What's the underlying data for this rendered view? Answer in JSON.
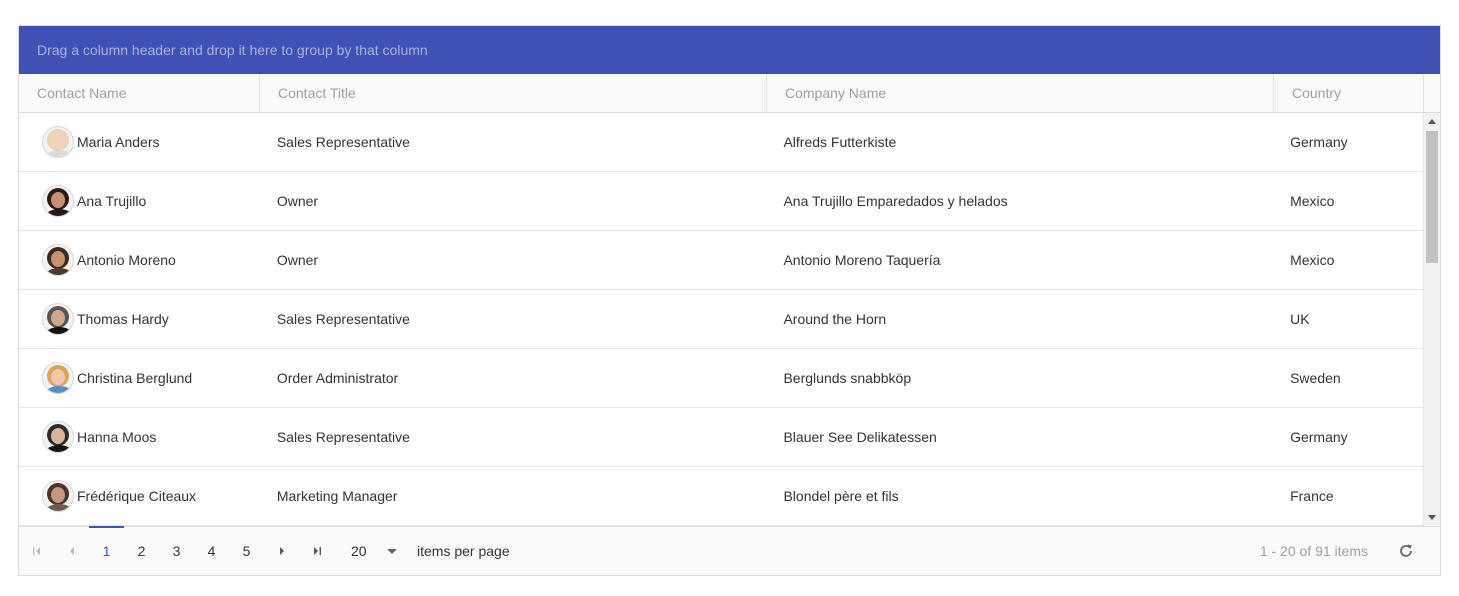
{
  "group_bar": {
    "text": "Drag a column header and drop it here to group by that column"
  },
  "columns": [
    "Contact Name",
    "Contact Title",
    "Company Name",
    "Country"
  ],
  "rows": [
    {
      "name": "Maria Anders",
      "title": "Sales Representative",
      "company": "Alfreds Futterkiste",
      "country": "Germany",
      "avatar": {
        "hair": "#e8d5b0",
        "skin": "#f2d3bd",
        "shirt": "#dcdcdc"
      }
    },
    {
      "name": "Ana Trujillo",
      "title": "Owner",
      "company": "Ana Trujillo Emparedados y helados",
      "country": "Mexico",
      "avatar": {
        "hair": "#2a1a12",
        "skin": "#c89070",
        "shirt": "#1c1c1c"
      }
    },
    {
      "name": "Antonio Moreno",
      "title": "Owner",
      "company": "Antonio Moreno Taquería",
      "country": "Mexico",
      "avatar": {
        "hair": "#3b2a1e",
        "skin": "#c9926f",
        "shirt": "#4a3a30"
      }
    },
    {
      "name": "Thomas Hardy",
      "title": "Sales Representative",
      "company": "Around the Horn",
      "country": "UK",
      "avatar": {
        "hair": "#555555",
        "skin": "#d0a88c",
        "shirt": "#111111"
      }
    },
    {
      "name": "Christina Berglund",
      "title": "Order Administrator",
      "company": "Berglunds snabbköp",
      "country": "Sweden",
      "avatar": {
        "hair": "#d9a35e",
        "skin": "#f0c7a8",
        "shirt": "#4f8fc9"
      }
    },
    {
      "name": "Hanna Moos",
      "title": "Sales Representative",
      "company": "Blauer See Delikatessen",
      "country": "Germany",
      "avatar": {
        "hair": "#2b2b2b",
        "skin": "#d8b59a",
        "shirt": "#151515"
      }
    },
    {
      "name": "Frédérique Citeaux",
      "title": "Marketing Manager",
      "company": "Blondel père et fils",
      "country": "France",
      "avatar": {
        "hair": "#4a3426",
        "skin": "#c8977a",
        "shirt": "#6a5a50"
      }
    }
  ],
  "pager": {
    "pages": [
      "1",
      "2",
      "3",
      "4",
      "5"
    ],
    "active_page": "1",
    "page_size": "20",
    "items_per_page_label": "items per page",
    "info": "1 - 20 of 91 items"
  },
  "colors": {
    "accent": "#3f51b5"
  },
  "icons": {
    "first": "first-page-icon",
    "prev": "prev-page-icon",
    "next": "next-page-icon",
    "last": "last-page-icon",
    "refresh": "refresh-icon",
    "dropdown": "chevron-down-icon"
  }
}
